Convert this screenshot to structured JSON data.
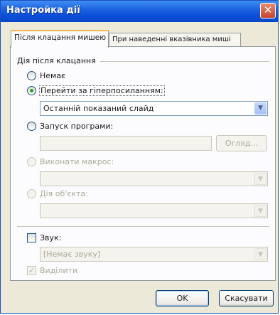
{
  "window": {
    "title": "Настройка дії",
    "close_glyph": "✕"
  },
  "tabs": [
    {
      "label": "Після клацання мишею"
    },
    {
      "label": "При наведенні вказівника миші"
    }
  ],
  "group": {
    "label": "Дія після клацання"
  },
  "options": {
    "none": {
      "label": "Немає",
      "selected": false,
      "enabled": true
    },
    "hyperlink": {
      "label": "Перейти за гіперпосиланням:",
      "selected": true,
      "enabled": true,
      "value": "Останній показаний слайд"
    },
    "program": {
      "label": "Запуск програми:",
      "selected": false,
      "enabled": true,
      "value": "",
      "browse_label": "Огляд..."
    },
    "macro": {
      "label": "Виконати макрос:",
      "selected": false,
      "enabled": false,
      "value": ""
    },
    "object_action": {
      "label": "Дія об'єкта:",
      "selected": false,
      "enabled": false,
      "value": ""
    }
  },
  "sound": {
    "label": "Звук:",
    "checked": false,
    "value": "[Немає звуку]"
  },
  "highlight": {
    "label": "Виділити",
    "checked": true,
    "enabled": false
  },
  "buttons": {
    "ok": "OK",
    "cancel": "Скасувати"
  },
  "colors": {
    "title_bar": "#0a4fd8",
    "close_button": "#c5452b",
    "active_tab_accent": "#f7b64b",
    "radio_selected_dot": "#21a121"
  }
}
